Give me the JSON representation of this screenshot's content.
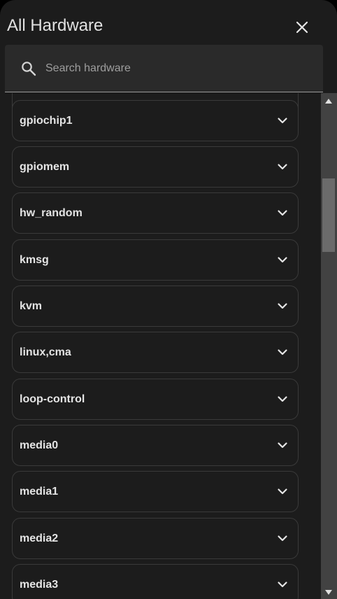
{
  "dialog": {
    "title": "All Hardware",
    "close_icon": "close-icon"
  },
  "search": {
    "icon": "search-icon",
    "placeholder": "Search hardware",
    "value": ""
  },
  "hardware": {
    "items": [
      {
        "label": "gpiochip1"
      },
      {
        "label": "gpiomem"
      },
      {
        "label": "hw_random"
      },
      {
        "label": "kmsg"
      },
      {
        "label": "kvm"
      },
      {
        "label": "linux,cma"
      },
      {
        "label": "loop-control"
      },
      {
        "label": "media0"
      },
      {
        "label": "media1"
      },
      {
        "label": "media2"
      },
      {
        "label": "media3"
      }
    ],
    "expand_icon": "chevron-down-icon"
  },
  "colors": {
    "background": "#1c1c1c",
    "card_border": "#3a3a3a",
    "search_bg": "#2a2a2a",
    "text": "#e4e4e4",
    "placeholder": "#9e9e9e",
    "scrollbar_track": "#424242",
    "scrollbar_thumb": "#6b6b6b"
  }
}
